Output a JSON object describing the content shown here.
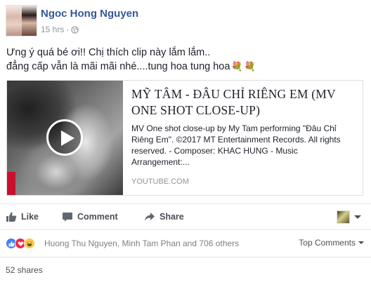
{
  "post": {
    "author": "Ngoc Hong Nguyen",
    "time": "15 hrs",
    "separator": "·",
    "privacy_icon": "globe-icon",
    "text_line1": "Ưng ý quá bé ơi!! Chị thích clip này lắm lắm..",
    "text_line2": "đẳng cấp vẫn là mãi mãi nhé....tung hoa tung hoa",
    "flower_icon": "bouquet-icon"
  },
  "link_card": {
    "title": "MỸ TÂM - ĐÂU CHỈ RIÊNG EM (MV ONE SHOT CLOSE-UP)",
    "description": "MV One shot close-up by My Tam performing \"Đâu Chỉ Riêng Em\". ©2017 MT Entertainment Records. All rights reserved. - Composer: KHAC HUNG - Music Arrangement:...",
    "domain": "YOUTUBE.COM"
  },
  "actions": {
    "like": "Like",
    "comment": "Comment",
    "share": "Share"
  },
  "reactions": {
    "names": "Huong Thu Nguyen, Minh Tam Phan and 706 others",
    "top_comments": "Top Comments",
    "icons": [
      "like-reaction-icon",
      "love-reaction-icon",
      "haha-reaction-icon"
    ]
  },
  "shares": "52 shares",
  "colors": {
    "author_link": "#365899",
    "meta_gray": "#90949c",
    "like_blue": "#4080ff",
    "love_red": "#f0284a",
    "haha_yellow": "#f7c94b"
  }
}
